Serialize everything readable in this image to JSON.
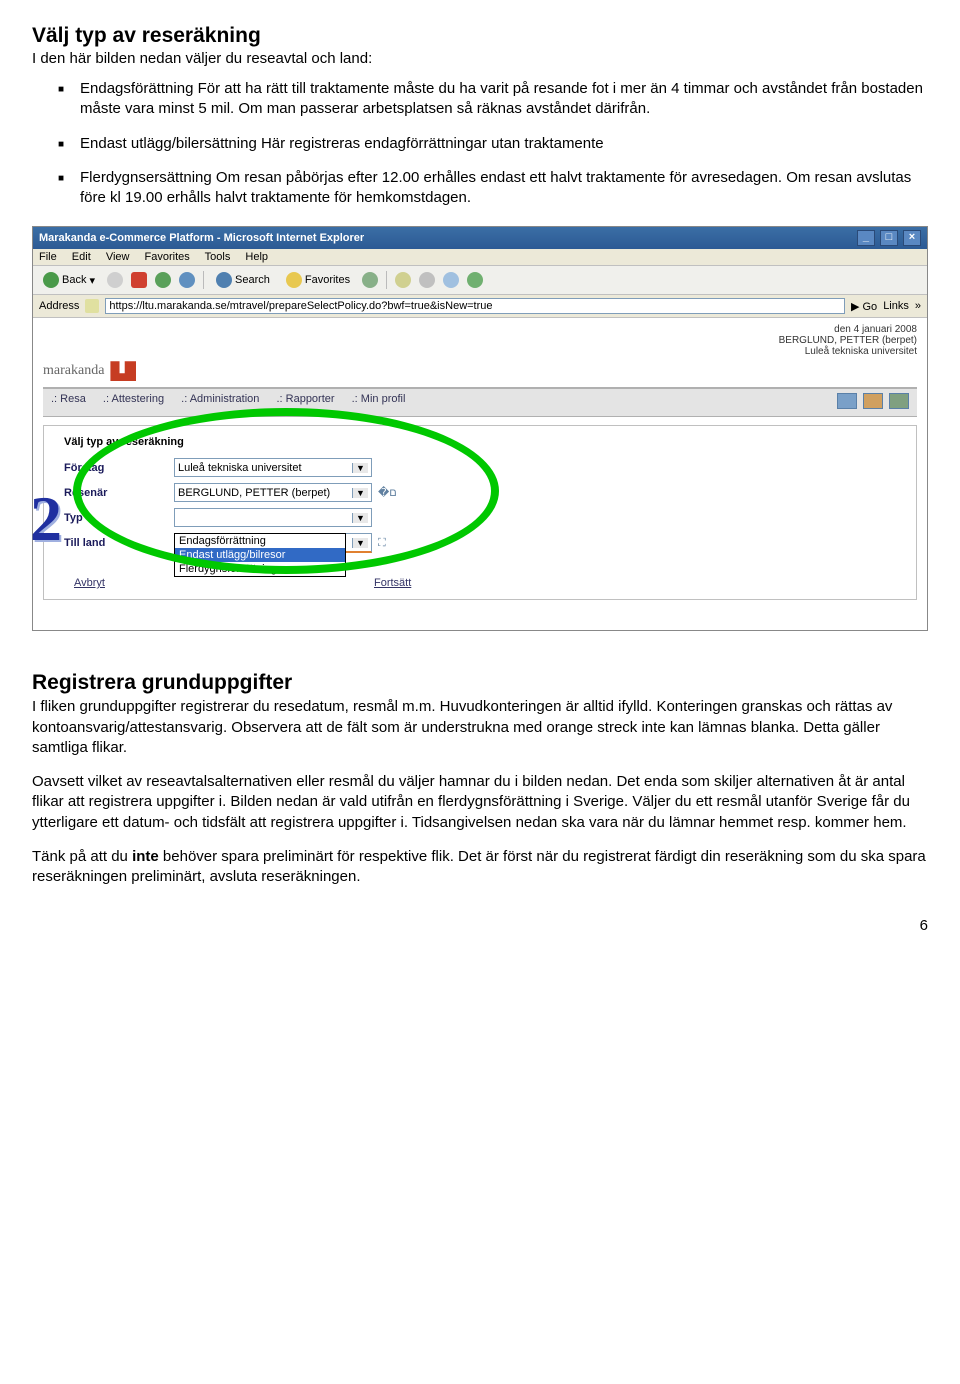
{
  "section1": {
    "title": "Välj typ av reseräkning",
    "intro": "I den här bilden nedan väljer du reseavtal och land:",
    "bullets": [
      "Endagsförättning För att ha rätt till traktamente måste du ha varit på resande fot i mer än 4 timmar och avståndet från bostaden måste vara minst 5 mil. Om man passerar arbetsplatsen så räknas avståndet därifrån.",
      "Endast utlägg/bilersättning Här registreras endagförrättningar utan traktamente",
      "Flerdygnsersättning Om resan påbörjas efter 12.00 erhålles endast ett halvt traktamente för avresedagen. Om resan avslutas före kl 19.00 erhålls halvt traktamente för hemkomstdagen."
    ]
  },
  "screenshot": {
    "window_title": "Marakanda e-Commerce Platform - Microsoft Internet Explorer",
    "menu": [
      "File",
      "Edit",
      "View",
      "Favorites",
      "Tools",
      "Help"
    ],
    "toolbar": {
      "back": "Back",
      "search": "Search",
      "favorites": "Favorites"
    },
    "address_label": "Address",
    "address_url": "https://ltu.marakanda.se/mtravel/prepareSelectPolicy.do?bwf=true&isNew=true",
    "go": "Go",
    "links": "Links",
    "date_line": "den 4 januari 2008",
    "user_line": "BERGLUND, PETTER (berpet)",
    "org_line": "Luleå tekniska universitet",
    "brand": "marakanda",
    "navtabs": [
      ".: Resa",
      ".: Attestering",
      ".: Administration",
      ".: Rapporter",
      ".: Min profil"
    ],
    "panel_title": "Välj typ av reseräkning",
    "labels": {
      "foretag": "Företag",
      "resenar": "Resenär",
      "typ": "Typ",
      "till_land": "Till land"
    },
    "fields": {
      "foretag": "Luleå tekniska universitet",
      "resenar": "BERGLUND, PETTER (berpet)",
      "typ": "",
      "till_land": ""
    },
    "dropdown_options": [
      "Endagsförrättning",
      "Endast utlägg/bilresor",
      "Flerdygnsförrättning"
    ],
    "btn_avbryt": "Avbryt",
    "btn_fortsatt": "Fortsätt",
    "annotation_number": "2"
  },
  "section2": {
    "title": "Registrera grunduppgifter",
    "p1": "I fliken grunduppgifter registrerar du resedatum, resmål m.m. Huvudkonteringen är alltid ifylld. Konteringen granskas och rättas av kontoansvarig/attestansvarig. Observera att de fält som är understrukna med orange streck inte kan lämnas blanka. Detta gäller samtliga flikar.",
    "p2": "Oavsett vilket av reseavtalsalternativen eller resmål du väljer hamnar du i bilden nedan. Det enda som skiljer alternativen åt är antal flikar att registrera uppgifter i. Bilden nedan är vald utifrån en flerdygnsförättning i Sverige. Väljer du ett resmål utanför Sverige får du ytterligare ett datum- och tidsfält att registrera uppgifter i. Tidsangivelsen nedan ska vara när du lämnar hemmet resp. kommer hem.",
    "p3_pre": "Tänk på att du ",
    "p3_bold": "inte",
    "p3_post": " behöver spara preliminärt för respektive flik. Det är först när du registrerat färdigt din reseräkning som du ska spara reseräkningen preliminärt, avsluta reseräkningen."
  },
  "page_number": "6"
}
